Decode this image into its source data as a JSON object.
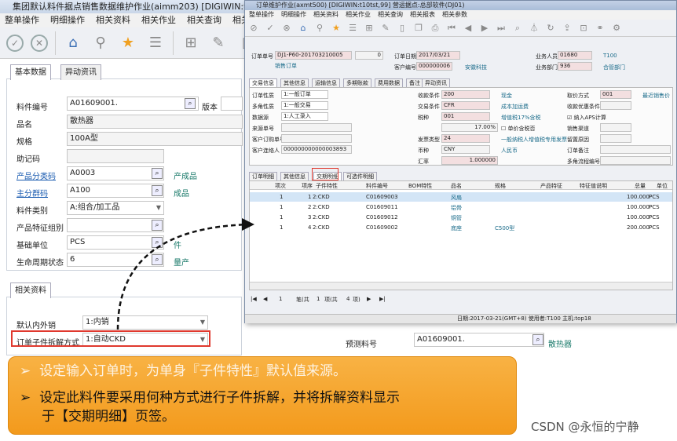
{
  "back": {
    "title": "集团默认料件据点销售数据维护作业(aimm203)      [DIGIWIN:t10",
    "menu": [
      "整单操作",
      "明细操作",
      "相关资料",
      "相关作业",
      "相关查询",
      "相关报"
    ],
    "tab_basic": "基本数据",
    "tab_change": "异动资讯",
    "fields": {
      "item_no": {
        "label": "料件编号",
        "value": "A01609001."
      },
      "version": {
        "label": "版本"
      },
      "name": {
        "label": "品名",
        "value": "散热器"
      },
      "spec": {
        "label": "规格",
        "value": "100A型"
      },
      "memo": {
        "label": "助记码"
      },
      "cat": {
        "label": "产品分类码",
        "value": "A0003",
        "desc": "产成品"
      },
      "group": {
        "label": "主分群码",
        "value": "A100",
        "desc": "成品"
      },
      "type": {
        "label": "料件类别",
        "value": "A:组合/加工品"
      },
      "feature": {
        "label": "产品特征组别"
      },
      "unit": {
        "label": "基础单位",
        "value": "PCS",
        "desc": "件"
      },
      "life": {
        "label": "生命周期状态",
        "value": "6",
        "desc": "量产"
      }
    },
    "tab_related": "相关资料",
    "domestic": {
      "label": "默认内外销",
      "value": "1:内销"
    },
    "split": {
      "label": "订单子件拆解方式",
      "value": "1:自动CKD"
    },
    "forecast": {
      "label": "预测料号",
      "value": "A01609001.",
      "desc": "散热器"
    }
  },
  "front": {
    "title": "订单维护作业(axmt500)    [DIGIWIN:t10tst,99]   营运据点:总部软件(DJ01)",
    "menu": [
      "整单操作",
      "明细操作",
      "相关资料",
      "相关作业",
      "相关查询",
      "相关报表",
      "相关参数"
    ],
    "order_no": {
      "label": "订单单号",
      "value": "DJ1-P60-201703210005",
      "no": "0",
      "type": "销售订单"
    },
    "order_date": {
      "label": "订单日期",
      "value": "2017/03/21"
    },
    "customer": {
      "label": "客户编号",
      "value": "000000006",
      "name": "安徽科技"
    },
    "salesman": {
      "label": "业务人员",
      "value": "01680",
      "name": "T100"
    },
    "dept": {
      "label": "业务部门",
      "value": "936",
      "name": "合管部门"
    },
    "tabs1": [
      "交易信息",
      "其他信息",
      "运输信息",
      "多期账款",
      "费用数据",
      "备注",
      "异动资讯"
    ],
    "t": {
      "order_nature": {
        "label": "订单性质",
        "value": "1:一般订单"
      },
      "multi_angle": {
        "label": "多角性质",
        "value": "1:一般交易"
      },
      "source": {
        "label": "数据源",
        "value": "1:人工录入"
      },
      "source_no": {
        "label": "来源单号"
      },
      "cust_po": {
        "label": "客户订购单号"
      },
      "contact": {
        "label": "客户连络人",
        "value": "000000000000003893"
      },
      "pay": {
        "label": "收款条件",
        "value": "200",
        "desc": "现金"
      },
      "trade": {
        "label": "交易条件",
        "value": "CFR",
        "desc": "成本加运费"
      },
      "tax": {
        "label": "税种",
        "value": "001",
        "desc": "增值税17%含税"
      },
      "taxrate": {
        "value": "17.00%",
        "desc": "单价含税否"
      },
      "invoice": {
        "label": "发票类型",
        "value": "24",
        "desc": "一般纳税人增值税专用发票"
      },
      "currency": {
        "label": "币种",
        "value": "CNY",
        "desc": "人民币"
      },
      "rate": {
        "label": "汇率",
        "value": "1.000000"
      },
      "price": {
        "label": "取价方式",
        "value": "001",
        "desc": "最近销售价"
      },
      "disc": {
        "label": "收款优惠条件"
      },
      "aps": {
        "label": "纳入APS计算"
      },
      "channel": {
        "label": "销售渠道"
      },
      "reason": {
        "label": "留置原因"
      },
      "note": {
        "label": "订单备注"
      },
      "flow": {
        "label": "多角流程编号"
      }
    },
    "tabs2": [
      "订单明细",
      "其他信息",
      "交期明细",
      "可选件明细"
    ],
    "cols": [
      "项次",
      "项序",
      "子件特性",
      "料件编号",
      "BOM特性",
      "品名",
      "规格",
      "产品特征",
      "特征值说明",
      "总量",
      "单位"
    ],
    "rows": [
      {
        "a": "1",
        "b": "1",
        "c": "2:CKD",
        "d": "C01609003",
        "n": "风扇",
        "s": "",
        "q": "100.000",
        "u": "PCS"
      },
      {
        "a": "1",
        "b": "2",
        "c": "2:CKD",
        "d": "C01609011",
        "n": "铝骨",
        "s": "",
        "q": "100.000",
        "u": "PCS"
      },
      {
        "a": "1",
        "b": "3",
        "c": "2:CKD",
        "d": "C01609012",
        "n": "铜管",
        "s": "",
        "q": "100.000",
        "u": "PCS"
      },
      {
        "a": "1",
        "b": "4",
        "c": "2:CKD",
        "d": "C01609002",
        "n": "底座",
        "s": "C500型",
        "q": "200.000",
        "u": "PCS"
      }
    ],
    "pager": {
      "page": "1",
      "label": "笔(共",
      "records": "1",
      "items_lbl": "项(共",
      "items": "4",
      "tail": "项)"
    },
    "status": "日期:2017-03-21(GMT+8)    使用者:T100    主机:top18"
  },
  "callout": {
    "b1": "设定输入订单时，为单身『子件特性』默认值来源。",
    "b2a": "设定此料件要采用何种方式进行子件拆解，并将拆解资料显示",
    "b2b": "于【交期明细】页签。"
  },
  "watermark": "CSDN @永恒的宁静"
}
